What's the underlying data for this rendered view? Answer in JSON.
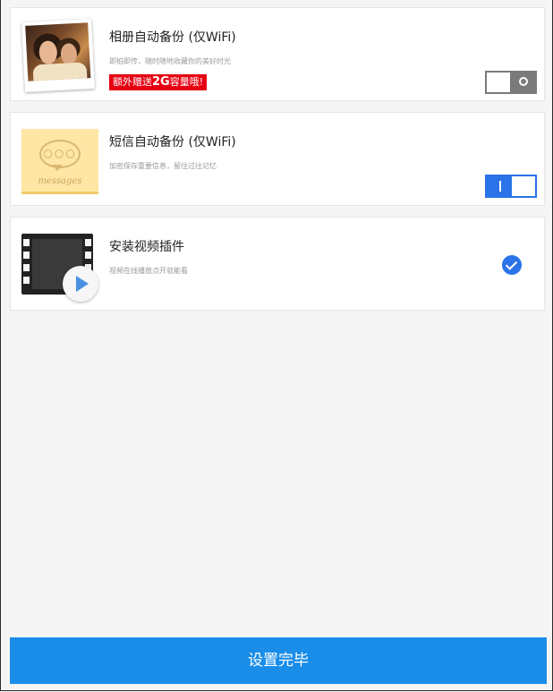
{
  "items": [
    {
      "title": "相册自动备份 (仅WiFi)",
      "subtitle": "即拍即传，随时随地收藏你的美好时光",
      "promo_prefix": "额外赠送",
      "promo_amount": "2G",
      "promo_suffix": "容量哦!",
      "icon": "photo-album-icon",
      "control": "toggle",
      "enabled": false
    },
    {
      "title": "短信自动备份 (仅WiFi)",
      "subtitle": "加密保存重要信息，留住过往记忆",
      "thumb_word": "messages",
      "thumb_dots": "○○○",
      "icon": "message-bubble-icon",
      "control": "toggle",
      "enabled": true
    },
    {
      "title": "安装视频插件",
      "subtitle": "视频在线播放点开就能看",
      "icon": "video-film-icon",
      "control": "checkbox",
      "checked": true
    }
  ],
  "done_button": "设置完毕",
  "colors": {
    "accent": "#2a73e8",
    "button": "#1a8de8",
    "promo": "#e60012",
    "toggle_off": "#7a7a7a"
  }
}
